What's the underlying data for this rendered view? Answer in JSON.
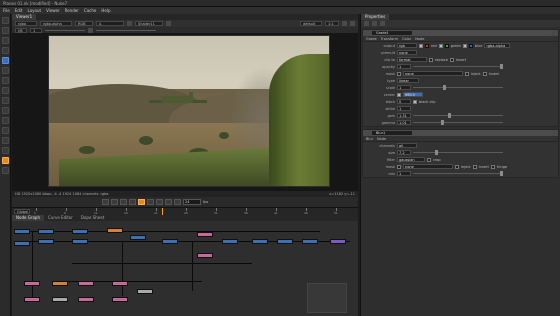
{
  "window": {
    "title": "Planes 01.nk  [modified] - Nuke7"
  },
  "menu": [
    "File",
    "Edit",
    "Layout",
    "Viewer",
    "Render",
    "Cache",
    "Help"
  ],
  "viewer": {
    "tab": "Viewer1",
    "channels": "rgba",
    "layer": "rgba.alpha",
    "display": "RGB",
    "input_a": "A",
    "input_b": "Shader11",
    "gain_label": "f/8",
    "gain_value": "1",
    "proxy": "default",
    "zoom": "1:1",
    "info_left": "HD 1920x1080 bbox: -4 -4 1924 1084 channels: rgba",
    "info_right": "x=1162 y=-11",
    "frame": "24",
    "fps": "fps"
  },
  "timeline": {
    "ticks": [
      "1",
      "6",
      "11",
      "16",
      "21",
      "26",
      "31",
      "36",
      "41",
      "46",
      "51"
    ],
    "mode": "Global"
  },
  "nodegraph": {
    "tabs": [
      "Node Graph",
      "Curve Editor",
      "Dope Sheet"
    ]
  },
  "properties": {
    "title": "Properties",
    "tabs": [
      "Properties"
    ],
    "panel1": {
      "name": "Grade1",
      "subtabs": [
        "Grade",
        "Transform",
        "Color",
        "Node"
      ],
      "rows": [
        {
          "label": "output",
          "value": "rgb",
          "extra": [
            "red",
            "green",
            "blue",
            "rgba.alpha"
          ]
        },
        {
          "label": "premult",
          "value": "none"
        },
        {
          "label": "clip to",
          "value": "format",
          "extra": [
            "replace",
            "invert"
          ]
        },
        {
          "label": "opacity",
          "value": "1"
        },
        {
          "label": "mask",
          "value": "none",
          "extra": [
            "inject",
            "invert"
          ]
        },
        {
          "label": "type",
          "value": "linear"
        },
        {
          "label": "scale",
          "value": "1"
        },
        {
          "label": "center",
          "value": "960.5"
        },
        {
          "label": "black",
          "value": "0",
          "extra": [
            "black clip"
          ]
        },
        {
          "label": "white",
          "value": "1"
        },
        {
          "label": "gain",
          "value": "1.31"
        },
        {
          "label": "gamma",
          "value": "1.01"
        }
      ]
    },
    "panel2": {
      "name": "Blur1",
      "subtabs": [
        "Blur",
        "Node"
      ],
      "rows": [
        {
          "label": "channels",
          "value": "all"
        },
        {
          "label": "size",
          "value": "7.2"
        },
        {
          "label": "filter",
          "value": "gaussian",
          "extra": [
            "crop"
          ]
        },
        {
          "label": "mask",
          "value": "none",
          "extra": [
            "inject",
            "invert",
            "fringe"
          ]
        },
        {
          "label": "mix",
          "value": "1"
        }
      ]
    }
  },
  "colors": {
    "accent": "#e08a2a",
    "node_blue": "#3f6fb3",
    "node_pink": "#c76a9a",
    "node_orange": "#d3803c",
    "node_purple": "#7a5ac8"
  }
}
